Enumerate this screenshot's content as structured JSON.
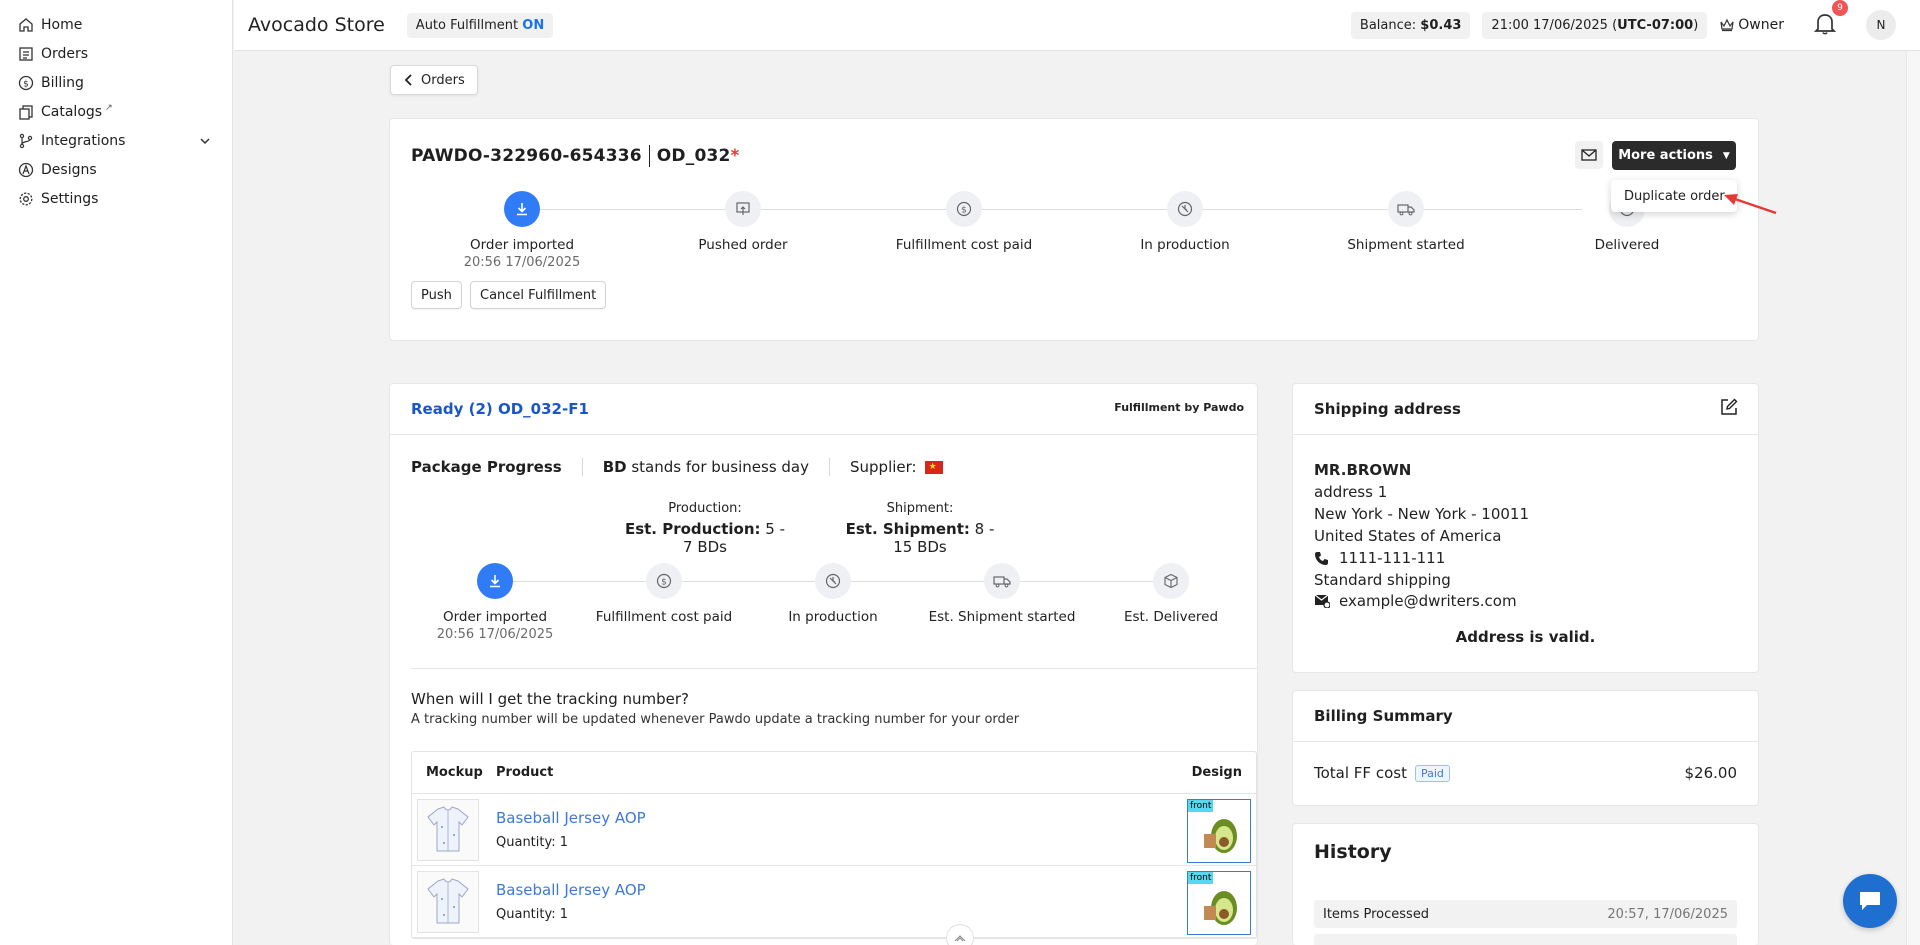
{
  "sidebar": {
    "items": [
      {
        "label": "Home",
        "icon": "home-icon"
      },
      {
        "label": "Orders",
        "icon": "orders-icon"
      },
      {
        "label": "Billing",
        "icon": "dollar-icon"
      },
      {
        "label": "Catalogs",
        "icon": "catalog-icon"
      },
      {
        "label": "Integrations",
        "icon": "branch-icon"
      },
      {
        "label": "Designs",
        "icon": "designs-icon"
      },
      {
        "label": "Settings",
        "icon": "gear-icon"
      }
    ]
  },
  "topbar": {
    "store_name": "Avocado Store",
    "auto_ff_label": "Auto Fulfillment",
    "auto_ff_state": "ON",
    "balance_label": "Balance:",
    "balance_value": "$0.43",
    "datetime": "21:00 17/06/2025 (",
    "timezone": "UTC-07:00",
    "datetime_close": ")",
    "owner": "Owner",
    "notifications": "9",
    "avatar": "N"
  },
  "back_label": "Orders",
  "order": {
    "id": "PAWDO-322960-654336",
    "code": "OD_032",
    "required_mark": "*",
    "more_actions": "More actions",
    "dropdown_item": "Duplicate order",
    "steps": [
      {
        "label": "Order imported",
        "date": "20:56 17/06/2025"
      },
      {
        "label": "Pushed order",
        "date": ""
      },
      {
        "label": "Fulfillment cost paid",
        "date": ""
      },
      {
        "label": "In production",
        "date": ""
      },
      {
        "label": "Shipment started",
        "date": ""
      },
      {
        "label": "Delivered",
        "date": ""
      }
    ],
    "push_btn": "Push",
    "cancel_btn": "Cancel Fulfillment"
  },
  "package": {
    "ready": "Ready (2) OD_032-F1",
    "ffby": "Fulfillment by Pawdo",
    "progress_title": "Package Progress",
    "bd": "BD",
    "bd_desc": " stands for business day",
    "supplier": "Supplier:",
    "production_title": "Production:",
    "production_label": "Est. Production:",
    "production_value": " 5 - 7 BDs",
    "shipment_title": "Shipment:",
    "shipment_label": "Est. Shipment:",
    "shipment_value": " 8 - 15 BDs",
    "steps": [
      {
        "label": "Order imported",
        "date": "20:56 17/06/2025"
      },
      {
        "label": "Fulfillment cost paid",
        "date": ""
      },
      {
        "label": "In production",
        "date": ""
      },
      {
        "label": "Est. Shipment started",
        "date": ""
      },
      {
        "label": "Est. Delivered",
        "date": ""
      }
    ],
    "when_title": "When will I get the tracking number?",
    "when_desc": "A tracking number will be updated whenever Pawdo update a tracking number for your order",
    "table_headers": [
      "Mockup",
      "Product",
      "Design"
    ],
    "rows": [
      {
        "name": "Baseball Jersey AOP",
        "qty": "Quantity: 1",
        "design_tag": "front"
      },
      {
        "name": "Baseball Jersey AOP",
        "qty": "Quantity: 1",
        "design_tag": "front"
      }
    ]
  },
  "shipping": {
    "title": "Shipping address",
    "name": "MR.BROWN",
    "line1": "address 1",
    "line2": "New York - New York - 10011",
    "country": "United States of America",
    "phone": "1111-111-111",
    "method": "Standard shipping",
    "email": "example@dwriters.com",
    "valid": "Address is valid."
  },
  "billing": {
    "title": "Billing Summary",
    "ff_label": "Total FF cost",
    "status": "Paid",
    "amount": "$26.00"
  },
  "history": {
    "title": "History",
    "items": [
      {
        "label": "Items Processed",
        "time": "20:57, 17/06/2025"
      }
    ]
  },
  "colors": {
    "accent": "#2f7cf6",
    "link": "#3b7ad9",
    "dark_button": "#2b2b2b",
    "alert": "#f05454"
  }
}
